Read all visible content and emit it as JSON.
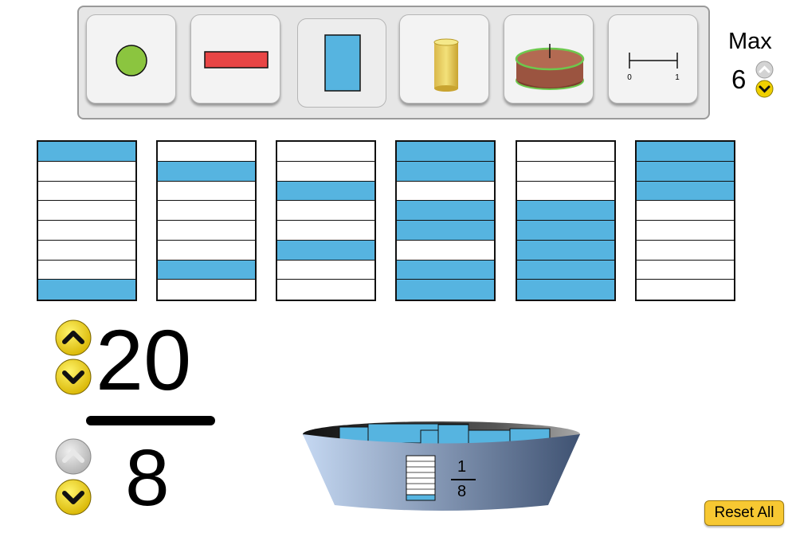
{
  "toolbar": {
    "representations": [
      {
        "name": "circle",
        "icon": "circle-icon",
        "selected": false
      },
      {
        "name": "horizontal-bar",
        "icon": "horizontal-bar-icon",
        "selected": false
      },
      {
        "name": "vertical-bar",
        "icon": "vertical-bar-icon",
        "selected": true
      },
      {
        "name": "water-glass",
        "icon": "water-glass-icon",
        "selected": false
      },
      {
        "name": "cake",
        "icon": "cake-icon",
        "selected": false
      },
      {
        "name": "number-line",
        "icon": "number-line-icon",
        "selected": false
      }
    ],
    "number_line_start": "0",
    "number_line_end": "1"
  },
  "max": {
    "label": "Max",
    "value": "6"
  },
  "containers": [
    {
      "cells": 8,
      "filled": [
        0,
        7
      ]
    },
    {
      "cells": 8,
      "filled": [
        1,
        6
      ]
    },
    {
      "cells": 8,
      "filled": [
        2,
        5
      ]
    },
    {
      "cells": 8,
      "filled": [
        0,
        1,
        3,
        4,
        6,
        7
      ]
    },
    {
      "cells": 8,
      "filled": [
        3,
        4,
        5,
        6,
        7
      ]
    },
    {
      "cells": 8,
      "filled": [
        0,
        1,
        2
      ]
    }
  ],
  "fraction": {
    "numerator": "20",
    "denominator": "8"
  },
  "bucket": {
    "label_numerator": "1",
    "label_denominator": "8"
  },
  "reset_label": "Reset All",
  "colors": {
    "fill": "#56b4e0",
    "yellow_button": "#f0d000",
    "gray_button": "#c8c8c8",
    "reset": "#f7c832"
  }
}
